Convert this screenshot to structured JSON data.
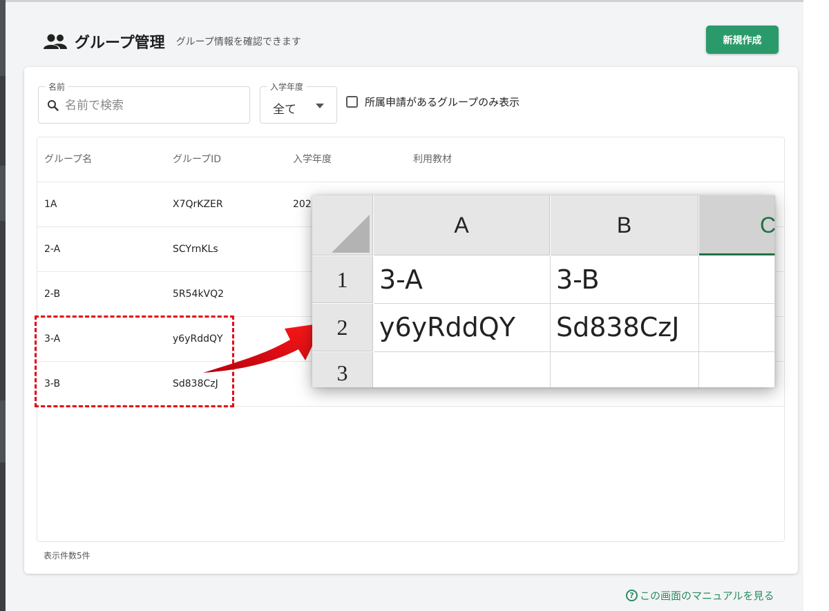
{
  "header": {
    "title": "グループ管理",
    "subtitle": "グループ情報を確認できます",
    "new_button": "新規作成"
  },
  "filters": {
    "name_label": "名前",
    "name_placeholder": "名前で検索",
    "year_label": "入学年度",
    "year_value": "全て",
    "checkbox_label": "所属申請があるグループのみ表示"
  },
  "table": {
    "headers": [
      "グループ名",
      "グループID",
      "入学年度",
      "利用教材"
    ],
    "rows": [
      {
        "name": "1A",
        "id": "X7QrKZER",
        "year": "202"
      },
      {
        "name": "2-A",
        "id": "SCYrnKLs",
        "year": ""
      },
      {
        "name": "2-B",
        "id": "5R54kVQ2",
        "year": ""
      },
      {
        "name": "3-A",
        "id": "y6yRddQY",
        "year": ""
      },
      {
        "name": "3-B",
        "id": "Sd838CzJ",
        "year": ""
      }
    ],
    "row_count": "表示件数5件"
  },
  "footer": {
    "manual_link": "この画面のマニュアルを見る"
  },
  "spreadsheet": {
    "columns": [
      "A",
      "B",
      "C"
    ],
    "rows": [
      "1",
      "2",
      "3"
    ],
    "cells": {
      "A1": "3-A",
      "B1": "3-B",
      "A2": "y6yRddQY",
      "B2": "Sd838CzJ"
    }
  },
  "colors": {
    "accent": "#2b9a6a",
    "highlight": "#e60012",
    "arrow": "#e60012"
  }
}
